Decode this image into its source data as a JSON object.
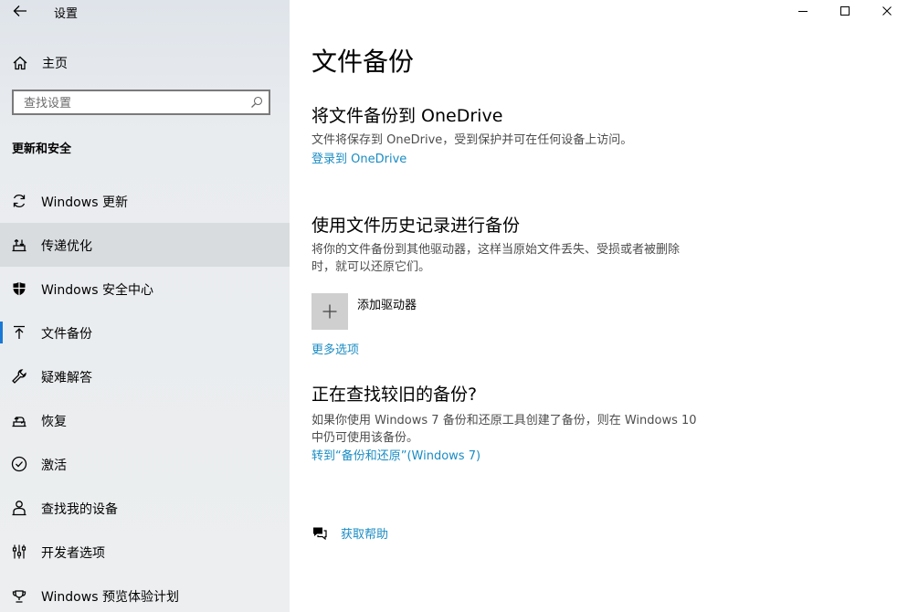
{
  "window": {
    "app_title": "设置"
  },
  "sidebar": {
    "home_label": "主页",
    "search_placeholder": "查找设置",
    "section_heading": "更新和安全",
    "items": [
      {
        "label": "Windows 更新",
        "icon": "sync-icon"
      },
      {
        "label": "传递优化",
        "icon": "delivery-optimization-icon"
      },
      {
        "label": "Windows 安全中心",
        "icon": "shield-icon"
      },
      {
        "label": "文件备份",
        "icon": "backup-arrow-icon"
      },
      {
        "label": "疑难解答",
        "icon": "wrench-icon"
      },
      {
        "label": "恢复",
        "icon": "recovery-icon"
      },
      {
        "label": "激活",
        "icon": "check-circle-icon"
      },
      {
        "label": "查找我的设备",
        "icon": "person-locate-icon"
      },
      {
        "label": "开发者选项",
        "icon": "developer-sliders-icon"
      },
      {
        "label": "Windows 预览体验计划",
        "icon": "insider-icon"
      }
    ]
  },
  "main": {
    "title": "文件备份",
    "onedrive": {
      "heading": "将文件备份到 OneDrive",
      "description": "文件将保存到 OneDrive，受到保护并可在任何设备上访问。",
      "link": "登录到 OneDrive"
    },
    "file_history": {
      "heading": "使用文件历史记录进行备份",
      "description_line1": "将你的文件备份到其他驱动器，这样当原始文件丢失、受损或者被删除",
      "description_line2": "时，就可以还原它们。",
      "add_drive_label": "添加驱动器",
      "more_options": "更多选项"
    },
    "older_backup": {
      "heading": "正在查找较旧的备份?",
      "description_line1": "如果你使用 Windows 7 备份和还原工具创建了备份，则在 Windows 10",
      "description_line2": "中仍可使用该备份。",
      "link": "转到“备份和还原”(Windows 7)"
    },
    "help_label": "获取帮助"
  }
}
